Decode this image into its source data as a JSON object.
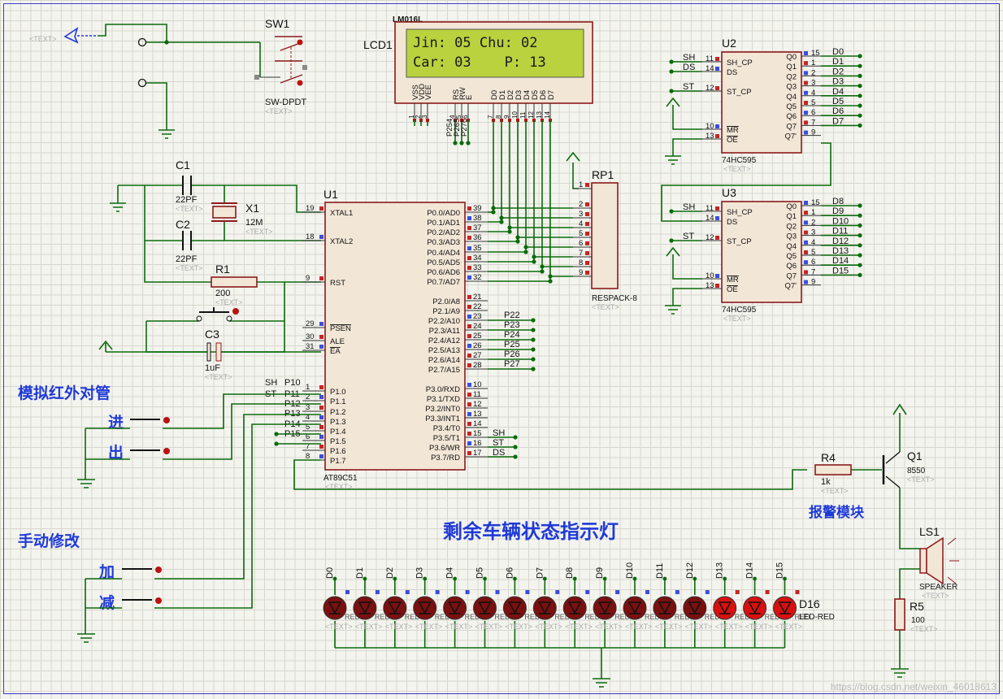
{
  "placeholder_text": "<TEXT>",
  "sw1": {
    "ref": "SW1",
    "type": "SW-DPDT"
  },
  "lcd": {
    "ref": "LCD1",
    "model": "LM016L",
    "line1": "Jin: 05 Chu: 02",
    "line2": "Car: 03    P: 13",
    "pins": [
      "VSS",
      "VDD",
      "VEE",
      "RS",
      "RW",
      "E",
      "D0",
      "D1",
      "D2",
      "D3",
      "D4",
      "D5",
      "D6",
      "D7"
    ],
    "pin_numbers": [
      "1",
      "2",
      "3",
      "4",
      "5",
      "6",
      "7",
      "8",
      "9",
      "10",
      "11",
      "12",
      "13",
      "14"
    ],
    "net_labels": [
      "P254",
      "P265",
      "P276"
    ]
  },
  "c1": {
    "ref": "C1",
    "value": "22PF"
  },
  "c2": {
    "ref": "C2",
    "value": "22PF"
  },
  "c3": {
    "ref": "C3",
    "value": "1uF"
  },
  "x1": {
    "ref": "X1",
    "value": "12M"
  },
  "r1": {
    "ref": "R1",
    "value": "200"
  },
  "r4": {
    "ref": "R4",
    "value": "1k"
  },
  "r5": {
    "ref": "R5",
    "value": "100"
  },
  "rp1": {
    "ref": "RP1",
    "type": "RESPACK-8",
    "pins": [
      "1",
      "2",
      "3",
      "4",
      "5",
      "6",
      "7",
      "8",
      "9"
    ]
  },
  "u1": {
    "ref": "U1",
    "type": "AT89C51",
    "left_pins": [
      {
        "num": "19",
        "name": "XTAL1"
      },
      {
        "num": "18",
        "name": "XTAL2"
      },
      {
        "num": "9",
        "name": "RST"
      },
      {
        "num": "29",
        "name": "PSEN"
      },
      {
        "num": "30",
        "name": "ALE"
      },
      {
        "num": "31",
        "name": "EA"
      },
      {
        "num": "1",
        "name": "P1.0"
      },
      {
        "num": "2",
        "name": "P1.1"
      },
      {
        "num": "3",
        "name": "P1.2"
      },
      {
        "num": "4",
        "name": "P1.3"
      },
      {
        "num": "5",
        "name": "P1.4"
      },
      {
        "num": "6",
        "name": "P1.5"
      },
      {
        "num": "7",
        "name": "P1.6"
      },
      {
        "num": "8",
        "name": "P1.7"
      }
    ],
    "right_pins": [
      {
        "num": "39",
        "name": "P0.0/AD0"
      },
      {
        "num": "38",
        "name": "P0.1/AD1"
      },
      {
        "num": "37",
        "name": "P0.2/AD2"
      },
      {
        "num": "36",
        "name": "P0.3/AD3"
      },
      {
        "num": "35",
        "name": "P0.4/AD4"
      },
      {
        "num": "34",
        "name": "P0.5/AD5"
      },
      {
        "num": "33",
        "name": "P0.6/AD6"
      },
      {
        "num": "32",
        "name": "P0.7/AD7"
      },
      {
        "num": "21",
        "name": "P2.0/A8"
      },
      {
        "num": "22",
        "name": "P2.1/A9"
      },
      {
        "num": "23",
        "name": "P2.2/A10"
      },
      {
        "num": "24",
        "name": "P2.3/A11"
      },
      {
        "num": "25",
        "name": "P2.4/A12"
      },
      {
        "num": "26",
        "name": "P2.5/A13"
      },
      {
        "num": "27",
        "name": "P2.6/A14"
      },
      {
        "num": "28",
        "name": "P2.7/A15"
      },
      {
        "num": "10",
        "name": "P3.0/RXD"
      },
      {
        "num": "11",
        "name": "P3.1/TXD"
      },
      {
        "num": "12",
        "name": "P3.2/INT0"
      },
      {
        "num": "13",
        "name": "P3.3/INT1"
      },
      {
        "num": "14",
        "name": "P3.4/T0"
      },
      {
        "num": "15",
        "name": "P3.5/T1"
      },
      {
        "num": "16",
        "name": "P3.6/WR"
      },
      {
        "num": "17",
        "name": "P3.7/RD"
      }
    ],
    "p1_labels": [
      "SH",
      "P10",
      "ST",
      "P11",
      "P12",
      "P13",
      "P14",
      "P15"
    ],
    "p2_labels": [
      "P22",
      "P23",
      "P24",
      "P25",
      "P26",
      "P27"
    ],
    "p3_labels": [
      "SH",
      "ST",
      "DS"
    ]
  },
  "u2": {
    "ref": "U2",
    "type": "74HC595",
    "left_pins": [
      {
        "num": "11",
        "name": "SH_CP",
        "net": "SH"
      },
      {
        "num": "14",
        "name": "DS",
        "net": "DS"
      },
      {
        "num": "12",
        "name": "ST_CP",
        "net": "ST"
      },
      {
        "num": "10",
        "name": "MR",
        "net": ""
      },
      {
        "num": "13",
        "name": "OE",
        "net": ""
      }
    ],
    "right_pins": [
      {
        "num": "15",
        "name": "Q0",
        "net": "D0"
      },
      {
        "num": "1",
        "name": "Q1",
        "net": "D1"
      },
      {
        "num": "2",
        "name": "Q2",
        "net": "D2"
      },
      {
        "num": "3",
        "name": "Q3",
        "net": "D3"
      },
      {
        "num": "4",
        "name": "Q4",
        "net": "D4"
      },
      {
        "num": "5",
        "name": "Q5",
        "net": "D5"
      },
      {
        "num": "6",
        "name": "Q6",
        "net": "D6"
      },
      {
        "num": "7",
        "name": "Q7",
        "net": "D7"
      },
      {
        "num": "9",
        "name": "Q7'",
        "net": ""
      }
    ]
  },
  "u3": {
    "ref": "U3",
    "type": "74HC595",
    "left_pins": [
      {
        "num": "11",
        "name": "SH_CP",
        "net": "SH"
      },
      {
        "num": "14",
        "name": "DS",
        "net": ""
      },
      {
        "num": "12",
        "name": "ST_CP",
        "net": "ST"
      },
      {
        "num": "10",
        "name": "MR",
        "net": ""
      },
      {
        "num": "13",
        "name": "OE",
        "net": ""
      }
    ],
    "right_pins": [
      {
        "num": "15",
        "name": "Q0",
        "net": "D8"
      },
      {
        "num": "1",
        "name": "Q1",
        "net": "D9"
      },
      {
        "num": "2",
        "name": "Q2",
        "net": "D10"
      },
      {
        "num": "3",
        "name": "Q3",
        "net": "D11"
      },
      {
        "num": "4",
        "name": "Q4",
        "net": "D12"
      },
      {
        "num": "5",
        "name": "Q5",
        "net": "D13"
      },
      {
        "num": "6",
        "name": "Q6",
        "net": "D14"
      },
      {
        "num": "7",
        "name": "Q7",
        "net": "D15"
      },
      {
        "num": "9",
        "name": "Q7'",
        "net": ""
      }
    ]
  },
  "q1": {
    "ref": "Q1",
    "value": "8550"
  },
  "ls1": {
    "ref": "LS1",
    "type": "SPEAKER"
  },
  "leds": {
    "labels": [
      "D0",
      "D1",
      "D2",
      "D3",
      "D4",
      "D5",
      "D6",
      "D7",
      "D8",
      "D9",
      "D10",
      "D11",
      "D12",
      "D13",
      "D14",
      "D15"
    ],
    "lit": [
      false,
      false,
      false,
      false,
      false,
      false,
      false,
      false,
      false,
      false,
      false,
      false,
      false,
      true,
      true,
      true
    ],
    "last_ref": "D16",
    "last_type": "LED-RED",
    "repeat_label": "RED"
  },
  "labels": {
    "ir_sim": "模拟红外对管",
    "in": "进",
    "out": "出",
    "manual": "手动修改",
    "add": "加",
    "sub": "减",
    "indicator": "剩余车辆状态指示灯",
    "alarm": "报警模块"
  },
  "watermark": "https://blog.csdn.net/weixin_46018613",
  "colors": {
    "wire": "#0b6b0b",
    "body": "#f2e6d6",
    "outline": "#8b1a1a",
    "label_blue": "#1f3ad8",
    "lcd": "#b9d23e",
    "led_off": "#7a1010",
    "led_on": "#d81010"
  }
}
